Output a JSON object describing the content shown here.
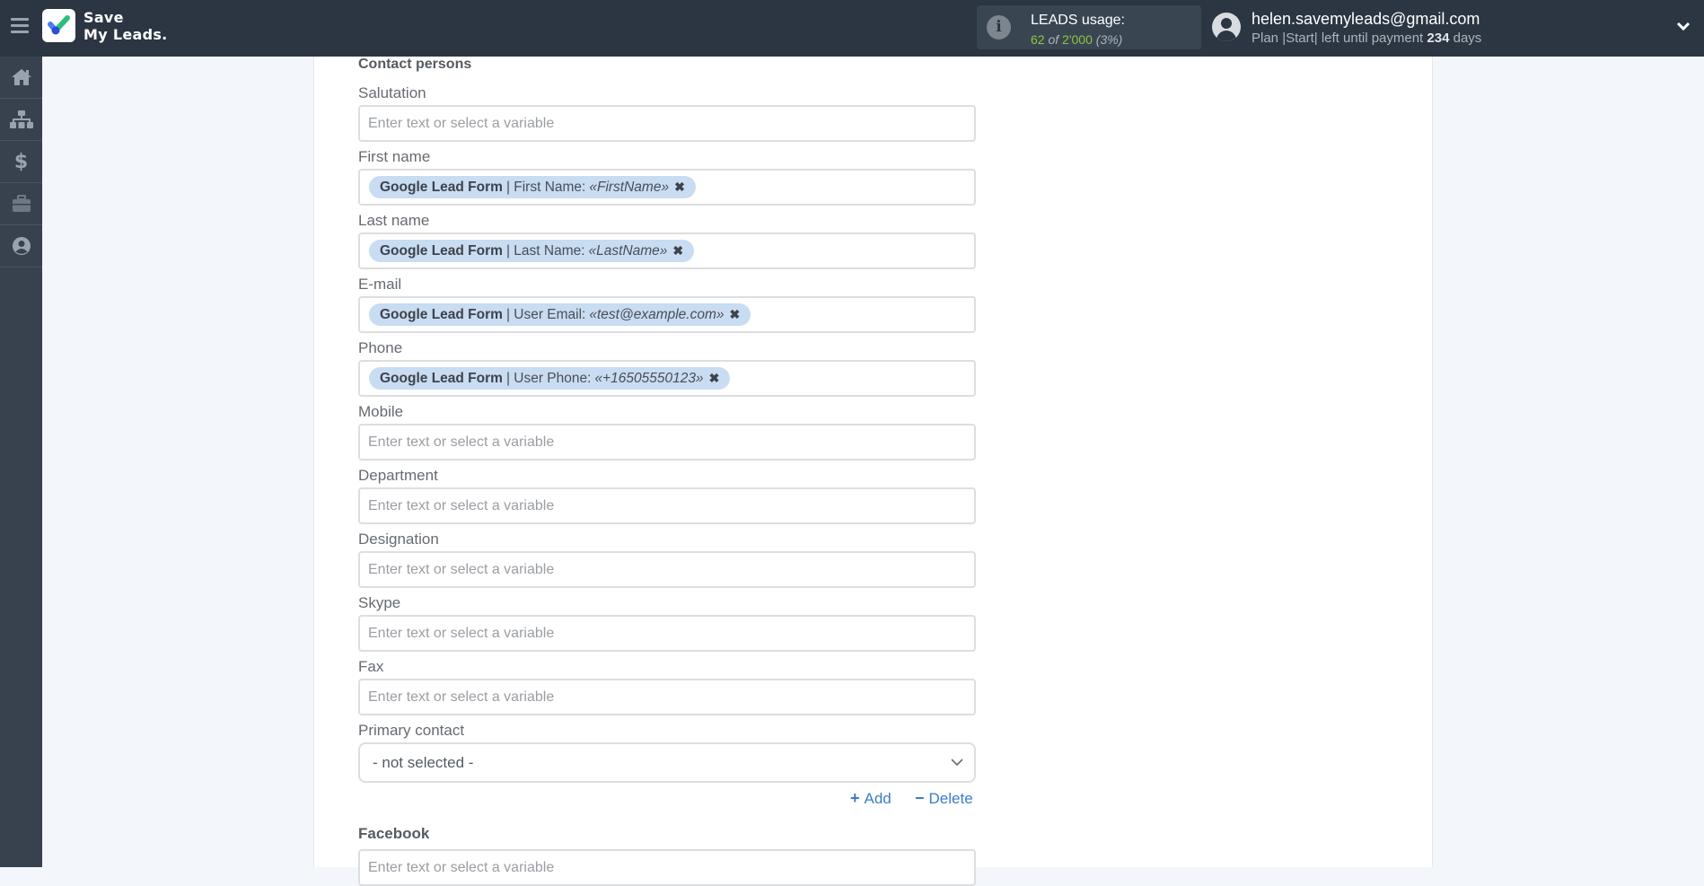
{
  "app": {
    "brand_line1": "Save",
    "brand_line2": "My Leads."
  },
  "usage": {
    "title": "LEADS usage:",
    "used": "62",
    "of_word": "of",
    "total": "2'000",
    "percent": "(3%)",
    "icon": "info-icon"
  },
  "user": {
    "email": "helen.savemyleads@gmail.com",
    "plan_prefix": "Plan |Start| left until payment",
    "days": "234",
    "days_suffix": "days"
  },
  "sidenav": [
    {
      "name": "home",
      "icon": "home-icon"
    },
    {
      "name": "connections",
      "icon": "sitemap-icon"
    },
    {
      "name": "billing",
      "icon": "dollar-icon"
    },
    {
      "name": "tools",
      "icon": "briefcase-icon"
    },
    {
      "name": "account",
      "icon": "user-circle-icon"
    }
  ],
  "form": {
    "section_title": "Contact persons",
    "placeholder": "Enter text or select a variable",
    "fields": [
      {
        "label": "Salutation",
        "value": null
      },
      {
        "label": "First name",
        "value": {
          "source": "Google Lead Form",
          "field": "| First Name:",
          "sample": "«FirstName»"
        }
      },
      {
        "label": "Last name",
        "value": {
          "source": "Google Lead Form",
          "field": "| Last Name:",
          "sample": "«LastName»"
        }
      },
      {
        "label": "E-mail",
        "value": {
          "source": "Google Lead Form",
          "field": "| User Email:",
          "sample": "«test@example.com»"
        }
      },
      {
        "label": "Phone",
        "value": {
          "source": "Google Lead Form",
          "field": "| User Phone:",
          "sample": "«+16505550123»"
        }
      },
      {
        "label": "Mobile",
        "value": null
      },
      {
        "label": "Department",
        "value": null
      },
      {
        "label": "Designation",
        "value": null
      },
      {
        "label": "Skype",
        "value": null
      },
      {
        "label": "Fax",
        "value": null
      }
    ],
    "primary_contact": {
      "label": "Primary contact",
      "selected": "- not selected -"
    },
    "add_label": "Add",
    "delete_label": "Delete",
    "facebook": {
      "label": "Facebook",
      "placeholder": "Enter text or select a variable"
    }
  },
  "colors": {
    "topbar": "#2c3542",
    "sidenav": "#38424f",
    "tag_bg": "#c8dcf2",
    "link": "#3b7dc4",
    "usage_green": "#8dc63f"
  }
}
